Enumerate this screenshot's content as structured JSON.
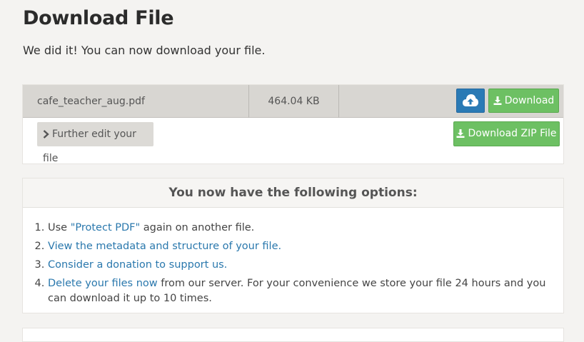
{
  "page": {
    "title": "Download File",
    "subtitle": "We did it! You can now download your file."
  },
  "file": {
    "name": "cafe_teacher_aug.pdf",
    "size": "464.04 KB",
    "cloud_icon": "cloud-upload-icon",
    "download_label": "Download",
    "further_edit_label": "Further edit your file",
    "download_zip_label": "Download ZIP File"
  },
  "options": {
    "heading": "You now have the following options:",
    "items": [
      {
        "pre": "Use ",
        "link": "\"Protect PDF\"",
        "post": " again on another file."
      },
      {
        "pre": "",
        "link": "View the metadata and structure of your file.",
        "post": ""
      },
      {
        "pre": "",
        "link": "Consider a donation to support us.",
        "post": ""
      },
      {
        "pre": "",
        "link": "Delete your files now",
        "post": " from our server. For your convenience we store your file 24 hours and you can download it up to 10 times."
      }
    ]
  },
  "colors": {
    "primary_green": "#6dc063",
    "cloud_blue": "#2a7ab5",
    "link_blue": "#2a78ad"
  }
}
